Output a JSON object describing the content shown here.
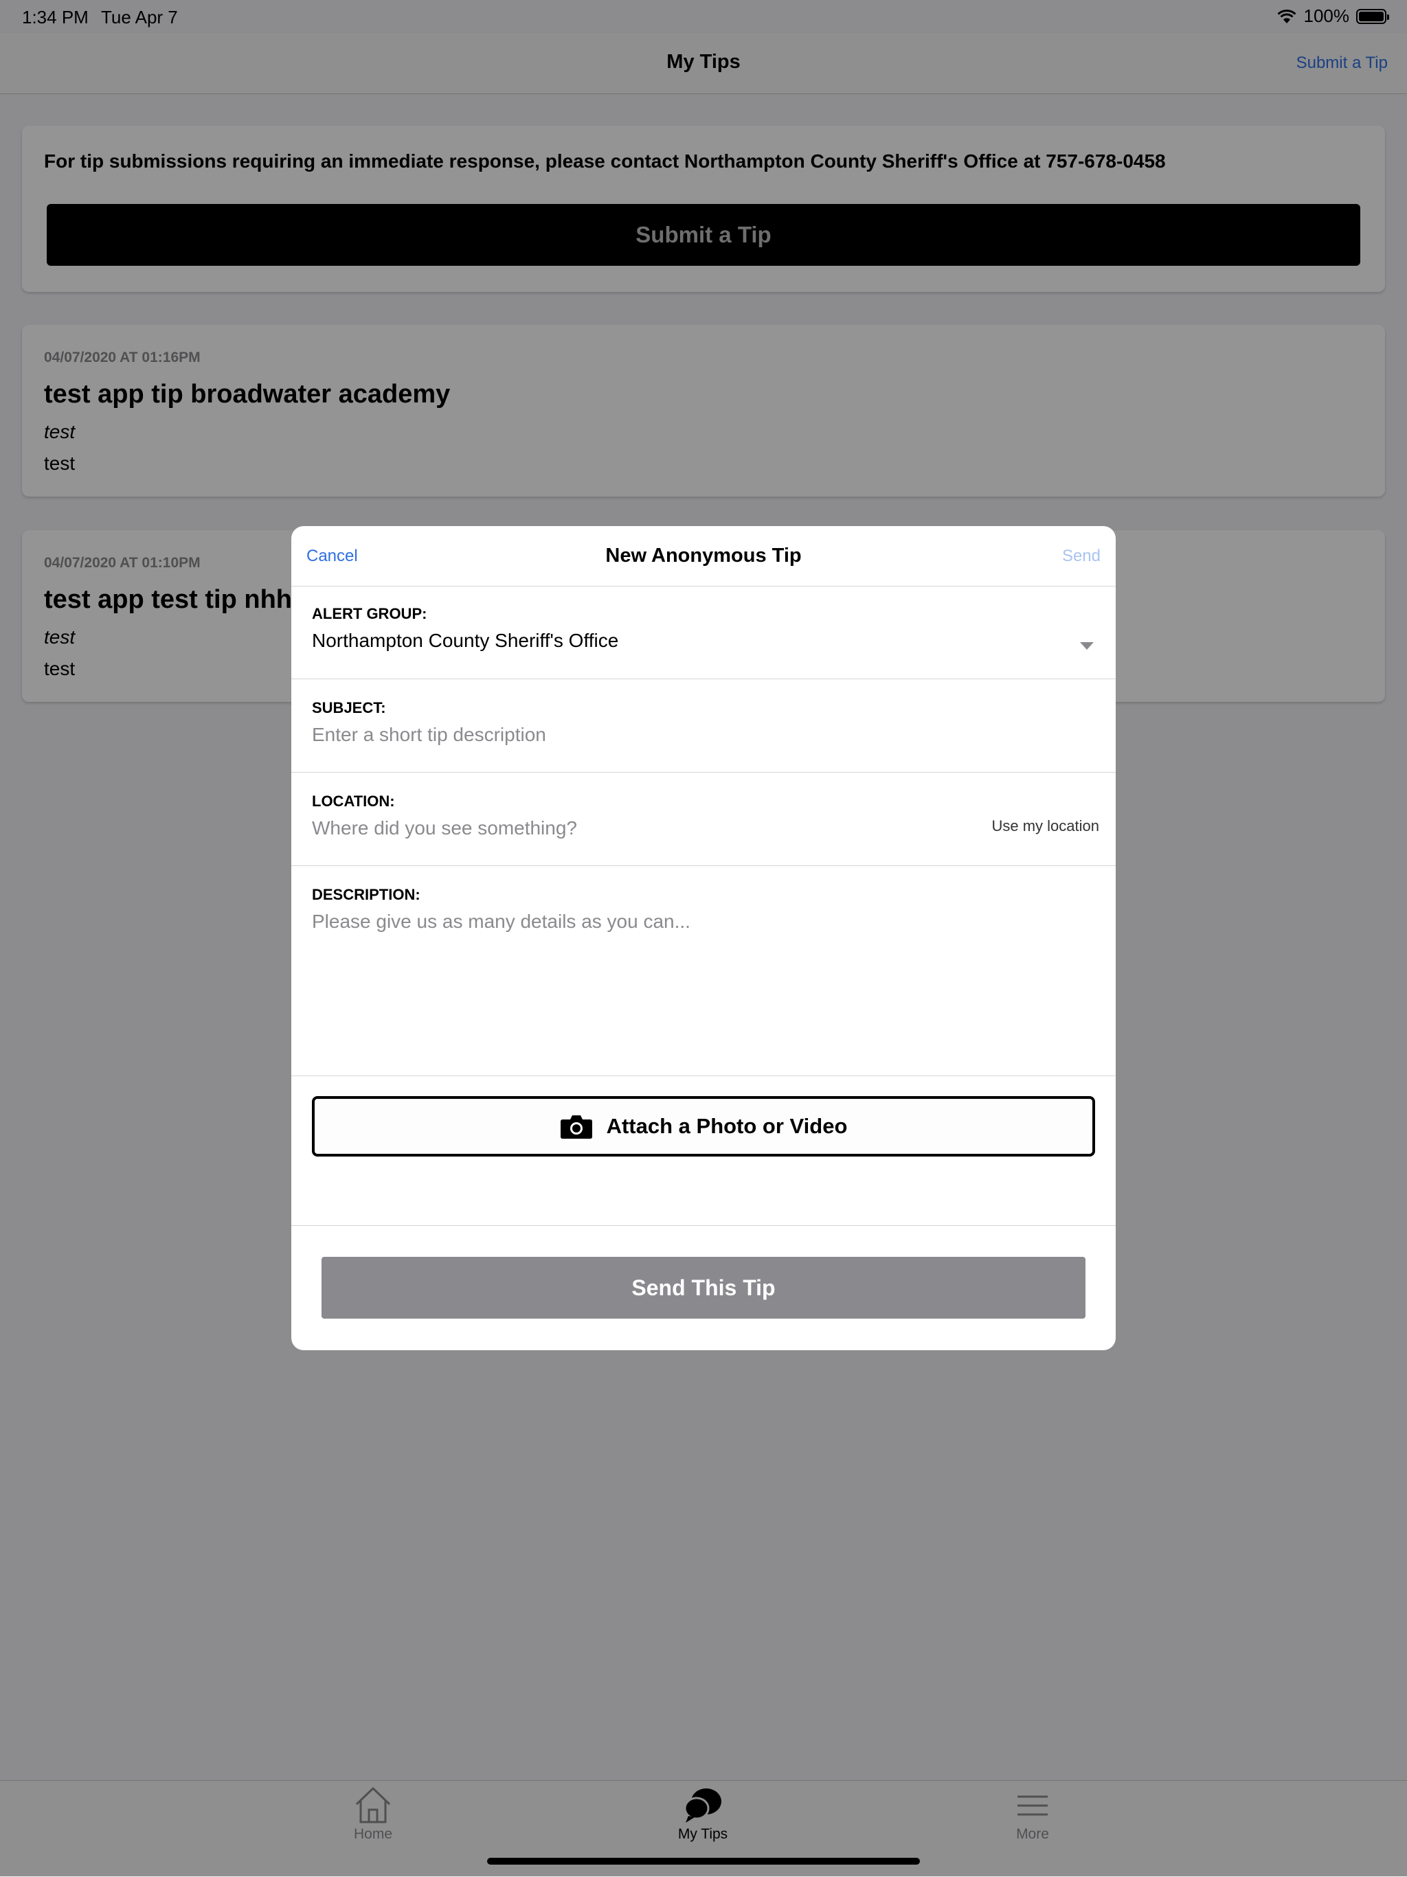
{
  "status_bar": {
    "time": "1:34 PM",
    "date": "Tue Apr 7",
    "battery": "100%"
  },
  "nav": {
    "title": "My Tips",
    "action": "Submit a Tip"
  },
  "notice": {
    "text": "For tip submissions requiring an immediate response, please contact Northampton County Sheriff's Office at 757-678-0458",
    "button": "Submit a Tip"
  },
  "tips": [
    {
      "date": "04/07/2020 AT 01:16PM",
      "title": "test app tip broadwater academy",
      "subject": "test",
      "body": "test"
    },
    {
      "date": "04/07/2020 AT 01:10PM",
      "title": "test app test tip nhh",
      "subject": "test",
      "body": "test"
    }
  ],
  "tabs": [
    {
      "label": "Home",
      "icon": "home-icon"
    },
    {
      "label": "My Tips",
      "icon": "chat-bubbles-icon",
      "active": true
    },
    {
      "label": "More",
      "icon": "menu-icon"
    }
  ],
  "modal": {
    "cancel": "Cancel",
    "title": "New Anonymous Tip",
    "send": "Send",
    "alert_group": {
      "label": "ALERT GROUP:",
      "value": "Northampton County Sheriff's Office"
    },
    "subject": {
      "label": "SUBJECT:",
      "placeholder": "Enter a short tip description"
    },
    "location": {
      "label": "LOCATION:",
      "placeholder": "Where did you see something?",
      "use_location": "Use my location"
    },
    "description": {
      "label": "DESCRIPTION:",
      "placeholder": "Please give us as many details as you can..."
    },
    "attach": "Attach a Photo or Video",
    "send_tip": "Send This Tip"
  },
  "colors": {
    "link": "#2f6fe0",
    "disabled_link": "#a9c4f0",
    "disabled_button": "#8a8a8e"
  }
}
